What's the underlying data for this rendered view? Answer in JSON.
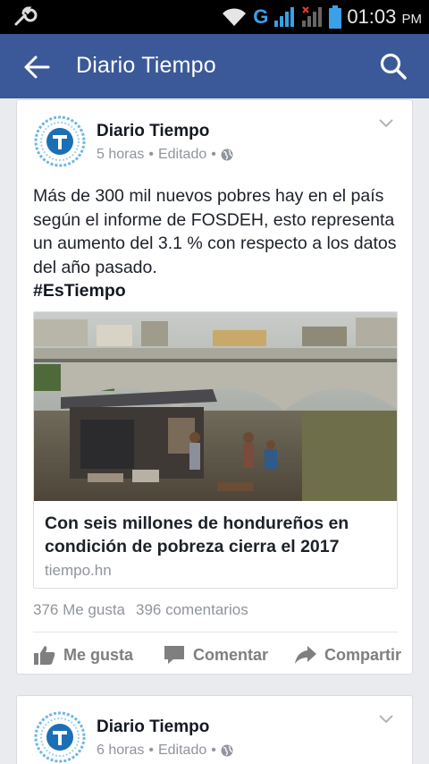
{
  "status_bar": {
    "network": "G",
    "time": "01:03",
    "ampm": "PM"
  },
  "app_bar": {
    "title": "Diario Tiempo"
  },
  "posts": [
    {
      "author": "Diario Tiempo",
      "time": "5 horas",
      "edited": "Editado",
      "text": "Más de 300 mil nuevos pobres hay en el país según el informe de FOSDEH, esto representa un aumento del 3.1 % con respecto a los datos del año pasado.",
      "hashtag": "#EsTiempo",
      "link": {
        "title": "Con seis millones de hondureños en condición de pobreza cierra el 2017",
        "domain": "tiempo.hn"
      },
      "likes": "376 Me gusta",
      "comments": "396 comentarios",
      "actions": {
        "like": "Me gusta",
        "comment": "Comentar",
        "share": "Compartir"
      }
    },
    {
      "author": "Diario Tiempo",
      "time": "6 horas",
      "edited": "Editado"
    }
  ],
  "colors": {
    "brand": "#3b5998",
    "background": "#e9ebee",
    "secondary_text": "#90949c"
  }
}
